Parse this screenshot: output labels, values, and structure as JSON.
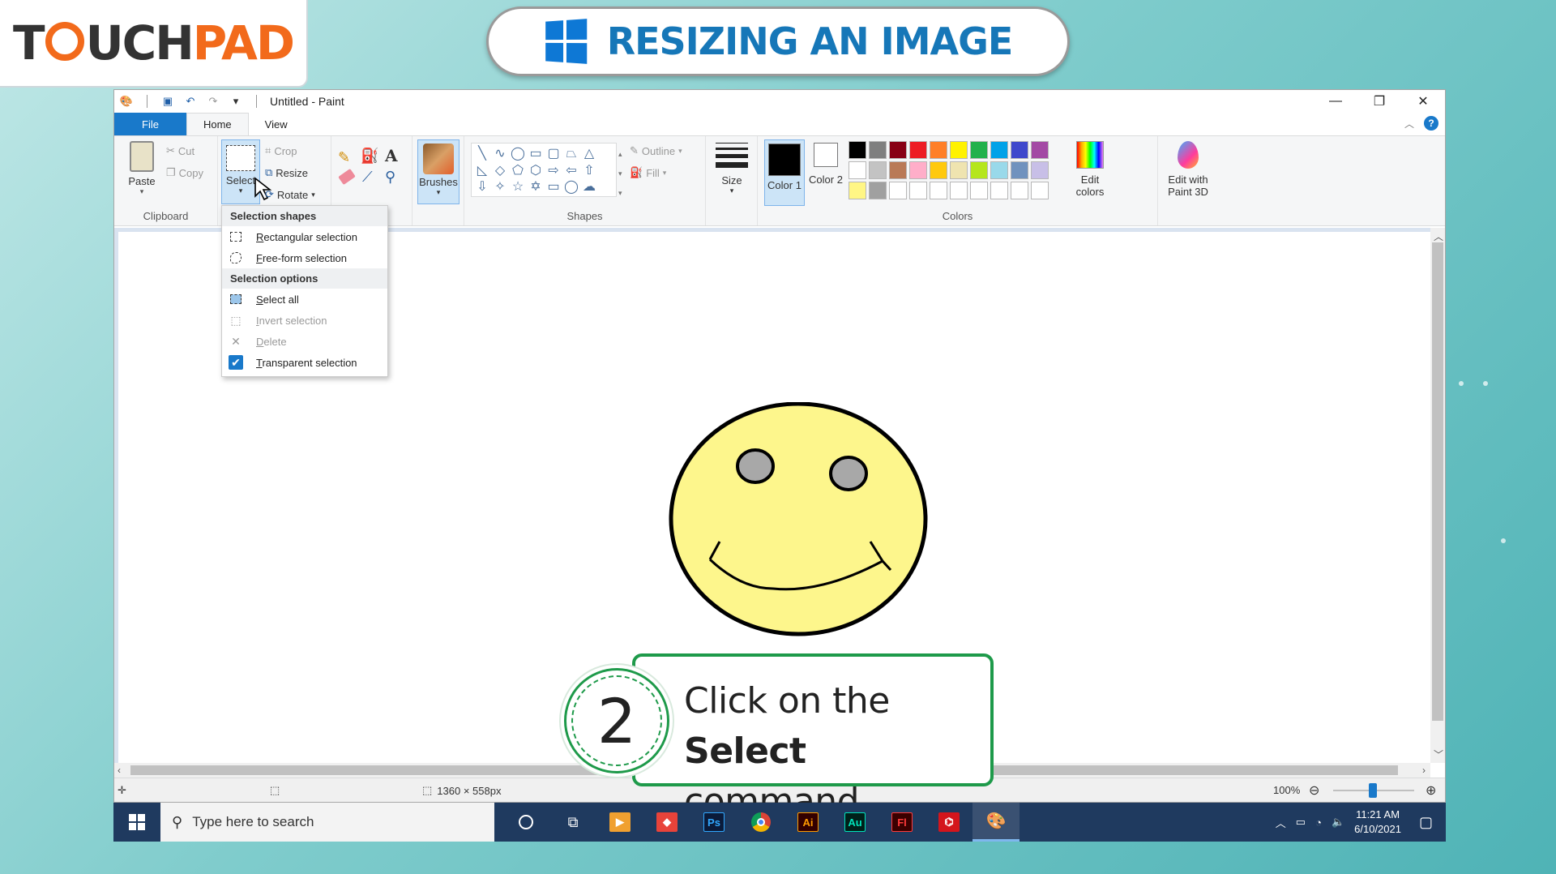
{
  "branding": {
    "logo_part1": "T",
    "logo_part2": "UCH",
    "logo_part3": "PAD"
  },
  "banner": {
    "title": "RESIZING AN IMAGE"
  },
  "window": {
    "title": "Untitled - Paint",
    "controls": {
      "minimize": "—",
      "restore": "❐",
      "close": "✕"
    }
  },
  "tabs": {
    "file": "File",
    "home": "Home",
    "view": "View"
  },
  "ribbon": {
    "clipboard": {
      "paste": "Paste",
      "cut": "Cut",
      "copy": "Copy",
      "label": "Clipboard"
    },
    "image": {
      "select": "Select",
      "crop": "Crop",
      "resize": "Resize",
      "rotate": "Rotate"
    },
    "tools": {
      "brushes": "Brushes"
    },
    "shapes": {
      "outline": "Outline",
      "fill": "Fill",
      "label": "Shapes"
    },
    "size": {
      "label": "Size"
    },
    "colors": {
      "color1": "Color 1",
      "color2": "Color 2",
      "edit_colors": "Edit colors",
      "edit_3d": "Edit with Paint 3D",
      "label": "Colors",
      "palette_row1": [
        "#000000",
        "#7f7f7f",
        "#880015",
        "#ed1c24",
        "#ff7f27",
        "#fff200",
        "#22b14c",
        "#00a2e8",
        "#3f48cc",
        "#a349a4"
      ],
      "palette_row2": [
        "#ffffff",
        "#c3c3c3",
        "#b97a57",
        "#ffaec9",
        "#ffc90e",
        "#efe4b0",
        "#b5e61d",
        "#99d9ea",
        "#7092be",
        "#c8bfe7"
      ],
      "palette_row3": [
        "#fff685",
        "#a0a0a0",
        "#ffffff",
        "#ffffff",
        "#ffffff",
        "#ffffff",
        "#ffffff",
        "#ffffff",
        "#ffffff",
        "#ffffff"
      ]
    }
  },
  "dropdown": {
    "header_shapes": "Selection shapes",
    "rectangular": "Rectangular selection",
    "freeform": "Free-form selection",
    "header_options": "Selection options",
    "select_all": "Select all",
    "invert": "Invert selection",
    "delete": "Delete",
    "transparent": "Transparent selection"
  },
  "statusbar": {
    "dimensions": "1360 × 558px",
    "zoom": "100%"
  },
  "callout": {
    "step": "2",
    "text_before": "Click on the ",
    "text_bold": "Select",
    "text_after": "command."
  },
  "taskbar": {
    "search_placeholder": "Type here to search",
    "time": "11:21 AM",
    "date": "6/10/2021",
    "apps": [
      "Ps",
      "Ai",
      "Au",
      "Fl"
    ]
  }
}
